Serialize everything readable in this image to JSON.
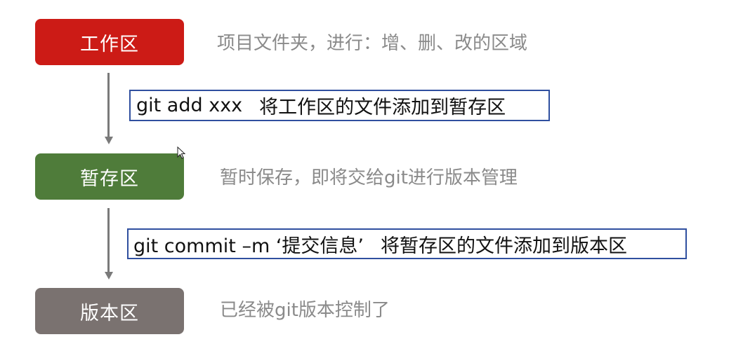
{
  "stages": [
    {
      "label": "工作区",
      "color": "#cc1b16",
      "description": "项目文件夹，进行：增、删、改的区域"
    },
    {
      "label": "暂存区",
      "color": "#4f7c3a",
      "description": "暂时保存，即将交给git进行版本管理"
    },
    {
      "label": "版本区",
      "color": "#7a7270",
      "description": "已经被git版本控制了"
    }
  ],
  "commands": [
    {
      "code": "git  add  xxx",
      "note": "将工作区的文件添加到暂存区"
    },
    {
      "code": "git  commit  –m  ‘提交信息’",
      "note": "将暂存区的文件添加到版本区"
    }
  ]
}
